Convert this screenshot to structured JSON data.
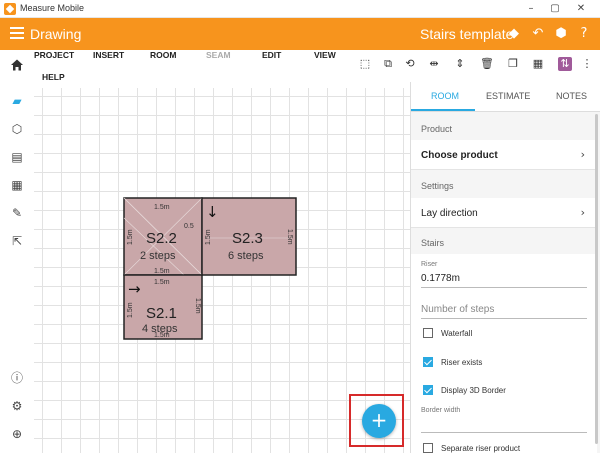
{
  "window": {
    "title": "Measure Mobile",
    "minimize": "–",
    "maximize": "▢",
    "close": "✕"
  },
  "header": {
    "title": "Drawing",
    "template_title": "Stairs template"
  },
  "menu": {
    "items": [
      "PROJECT",
      "INSERT",
      "ROOM",
      "SEAM",
      "EDIT",
      "VIEW",
      "HELP"
    ]
  },
  "drawing": {
    "rooms": [
      {
        "name": "S2.2",
        "steps": "2 steps",
        "top": "1.5m",
        "bottom": "1.5m",
        "left": "1.5m",
        "right": "1.5m",
        "extra": "0.5",
        "arrow": ""
      },
      {
        "name": "S2.3",
        "steps": "6 steps",
        "top": "1.5m",
        "bottom": "",
        "left": "1.5m",
        "right": "1.5m",
        "extra": "",
        "arrow": "↓"
      },
      {
        "name": "S2.1",
        "steps": "4 steps",
        "top": "1.5m",
        "bottom": "1.5m",
        "left": "1.5m",
        "right": "1.5m",
        "extra": "",
        "arrow": "→"
      }
    ],
    "room_fill": "#c9a7a9"
  },
  "panel": {
    "tabs": [
      "ROOM",
      "ESTIMATE",
      "NOTES"
    ],
    "product_section": "Product",
    "choose_product": "Choose product",
    "settings_section": "Settings",
    "lay_direction": "Lay direction",
    "stairs_section": "Stairs",
    "riser_label": "Riser",
    "riser_value": "0.1778m",
    "steps_placeholder": "Number of steps",
    "checkboxes": [
      {
        "label": "Waterfall",
        "checked": false
      },
      {
        "label": "Riser exists",
        "checked": true
      },
      {
        "label": "Display 3D Border",
        "checked": true
      }
    ],
    "border_width_label": "Border width",
    "separate_riser": "Separate riser product"
  },
  "fab": {
    "label": "+"
  },
  "colors": {
    "accent": "#f7941d",
    "blue": "#29a9e1",
    "highlight": "#d62a2a"
  }
}
